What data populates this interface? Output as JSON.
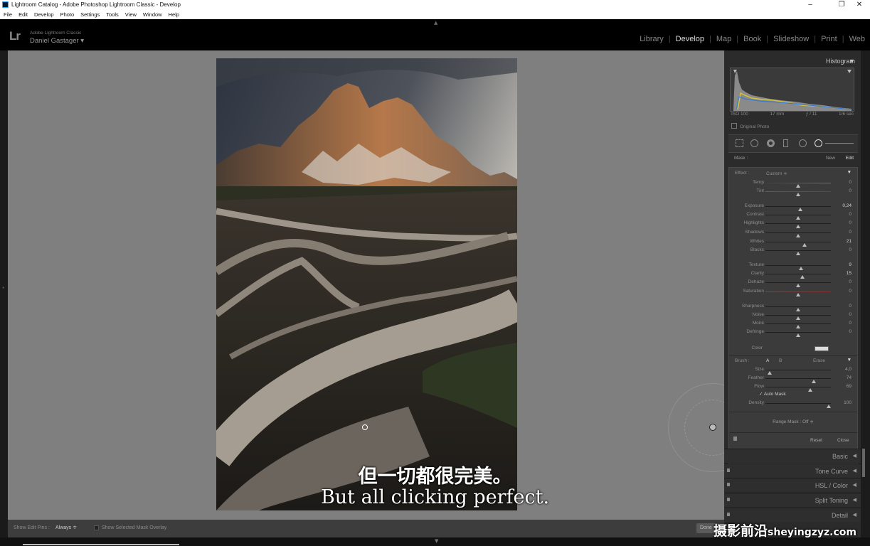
{
  "window": {
    "title": "Lightroom Catalog - Adobe Photoshop Lightroom Classic - Develop",
    "controls": {
      "minimize": "–",
      "maximize": "❐",
      "close": "✕"
    }
  },
  "menu": [
    "File",
    "Edit",
    "Develop",
    "Photo",
    "Settings",
    "Tools",
    "View",
    "Window",
    "Help"
  ],
  "identity": {
    "logo": "Lr",
    "product": "Adobe Lightroom Classic",
    "user": "Daniel Gastager",
    "user_menu_glyph": "▾"
  },
  "modules": {
    "library": "Library",
    "develop": "Develop",
    "map": "Map",
    "book": "Book",
    "slideshow": "Slideshow",
    "print": "Print",
    "web": "Web",
    "separator": "|",
    "active": "Develop"
  },
  "histogram": {
    "title": "Histogram",
    "exif": {
      "iso": "ISO 100",
      "focal": "17 mm",
      "aperture": "ƒ / 11",
      "shutter": "1/6 sec"
    },
    "original_photo": "Original Photo"
  },
  "mask": {
    "label": "Mask :",
    "new": "New",
    "edit": "Edit"
  },
  "effect": {
    "label": "Effect :",
    "preset": "Custom ≑",
    "sliders": {
      "temp": {
        "label": "Temp",
        "value": "0",
        "pos": 0.5
      },
      "tint": {
        "label": "Tint",
        "value": "0",
        "pos": 0.5
      },
      "exposure": {
        "label": "Exposure",
        "value": "0,24",
        "pos": 0.53
      },
      "contrast": {
        "label": "Contrast",
        "value": "0",
        "pos": 0.5
      },
      "highlights": {
        "label": "Highlights",
        "value": "0",
        "pos": 0.5
      },
      "shadows": {
        "label": "Shadows",
        "value": "0",
        "pos": 0.5
      },
      "whites": {
        "label": "Whites",
        "value": "21",
        "pos": 0.6
      },
      "blacks": {
        "label": "Blacks",
        "value": "0",
        "pos": 0.5
      },
      "texture": {
        "label": "Texture",
        "value": "9",
        "pos": 0.54
      },
      "clarity": {
        "label": "Clarity",
        "value": "15",
        "pos": 0.57
      },
      "dehaze": {
        "label": "Dehaze",
        "value": "0",
        "pos": 0.5
      },
      "saturation": {
        "label": "Saturation",
        "value": "0",
        "pos": 0.5
      },
      "sharpness": {
        "label": "Sharpness",
        "value": "0",
        "pos": 0.5
      },
      "noise": {
        "label": "Noise",
        "value": "0",
        "pos": 0.5
      },
      "moire": {
        "label": "Moiré",
        "value": "0",
        "pos": 0.5
      },
      "defringe": {
        "label": "Defringe",
        "value": "0",
        "pos": 0.5
      }
    },
    "color_label": "Color"
  },
  "brush": {
    "label": "Brush :",
    "a": "A",
    "b": "B",
    "erase": "Erase",
    "size": {
      "label": "Size",
      "value": "4,0",
      "pos": 0.07
    },
    "feather": {
      "label": "Feather",
      "value": "74",
      "pos": 0.74
    },
    "flow": {
      "label": "Flow",
      "value": "69",
      "pos": 0.69
    },
    "auto_mask": "Auto Mask",
    "density": {
      "label": "Density",
      "value": "100",
      "pos": 0.97
    }
  },
  "range_mask": "Range Mask : Off ≑",
  "reset": "Reset",
  "close": "Close",
  "panels": [
    "Basic",
    "Tone Curve",
    "HSL / Color",
    "Split Toning",
    "Detail"
  ],
  "toolbar": {
    "show_edit_pins": "Show Edit Pins :",
    "pins_value": "Always ≑",
    "show_overlay": "Show Selected Mask Overlay",
    "done": "Done"
  },
  "subtitles": {
    "cn": "但一切都很完美。",
    "en": "But all clicking perfect."
  },
  "watermark": {
    "cn": "摄影前沿",
    "domain": "sheyingzyz.com"
  },
  "colors": {
    "accent": "#dcdcdc",
    "panel": "#2b2b2b",
    "canvas": "#7f7f7f"
  }
}
